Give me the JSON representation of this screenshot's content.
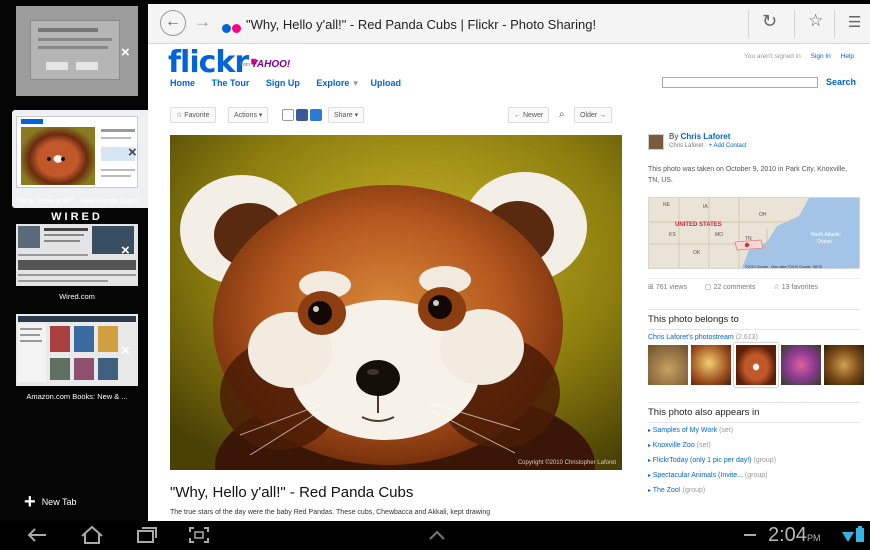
{
  "tabs": [
    {
      "title": "",
      "close": "×"
    },
    {
      "title": "\"Why, Hello y'all!\" - Red Panda Cubs",
      "close": "×"
    },
    {
      "title": "Wired.com",
      "close": "×",
      "masthead": "WIRED"
    },
    {
      "title": "Amazon.com Books: New & ...",
      "close": "×"
    }
  ],
  "new_tab_label": "New Tab",
  "address_bar": {
    "title": "\"Why, Hello y'all!\" - Red Panda Cubs | Flickr - Photo Sharing!",
    "icons": [
      "back-icon",
      "forward-icon",
      "reload-icon",
      "bookmark-star-icon",
      "menu-icon"
    ]
  },
  "flickr": {
    "logo": "flickr",
    "logo_from": "from",
    "logo_yahoo": "YAHOO!",
    "nav": [
      "Home",
      "The Tour",
      "Sign Up",
      "Explore",
      "Upload"
    ],
    "nav_caret": "▾",
    "not_signed_in": "You aren't signed in",
    "sign_in": "Sign In",
    "help": "Help",
    "search_label": "Search",
    "actions": {
      "favorite": "Favorite",
      "actions": "Actions ▾",
      "share": "Share ▾",
      "newer": "← Newer",
      "older": "Older →"
    },
    "photo_credit": "Copyright ©2010 Christopher Laforet",
    "photo_title": "\"Why, Hello y'all!\" - Red Panda Cubs",
    "photo_desc": "The true stars of the day were the baby Red Pandas. These cubs, Chewbacca and Akkali, kept drawing",
    "owner": {
      "by": "By",
      "name": "Chris Laforet",
      "sub_name": "Chris Laforet",
      "add_contact": "+ Add Contact"
    },
    "taken_on": "This photo was taken on October 9, 2010 in Park City, Knoxville, TN, US.",
    "map_labels": [
      "NE",
      "IA",
      "UNITED STATES",
      "KS",
      "OK",
      "MO",
      "OH",
      "TN",
      "North Atlantic Ocean",
      "©2010 Google - Map data ©2010 Google, INEGI"
    ],
    "stats": {
      "views": "761 views",
      "comments": "22 comments",
      "favorites": "13 favorites"
    },
    "belongs_heading": "This photo belongs to",
    "photostream": "Chris Laforet's photostream",
    "photostream_count": "(2,613)",
    "appears_heading": "This photo also appears in",
    "sets": [
      {
        "name": "Samples of My Work",
        "kind": "(set)"
      },
      {
        "name": "Knoxville Zoo",
        "kind": "(set)"
      },
      {
        "name": "FlickrToday (only 1 pic per day!)",
        "kind": "(group)"
      },
      {
        "name": "Spectacular Animals (Invite...",
        "kind": "(group)"
      },
      {
        "name": "The Zoo!",
        "kind": "(group)"
      }
    ]
  },
  "system_bar": {
    "time": "2:04",
    "ampm": "PM",
    "icons": [
      "back-nav-icon",
      "home-nav-icon",
      "recent-apps-icon",
      "screenshot-icon",
      "expand-up-icon",
      "wifi-icon",
      "battery-icon"
    ]
  },
  "colors": {
    "flickr_blue": "#0063dc",
    "flickr_pink": "#ff0084",
    "yahoo_purple": "#7b0099"
  }
}
